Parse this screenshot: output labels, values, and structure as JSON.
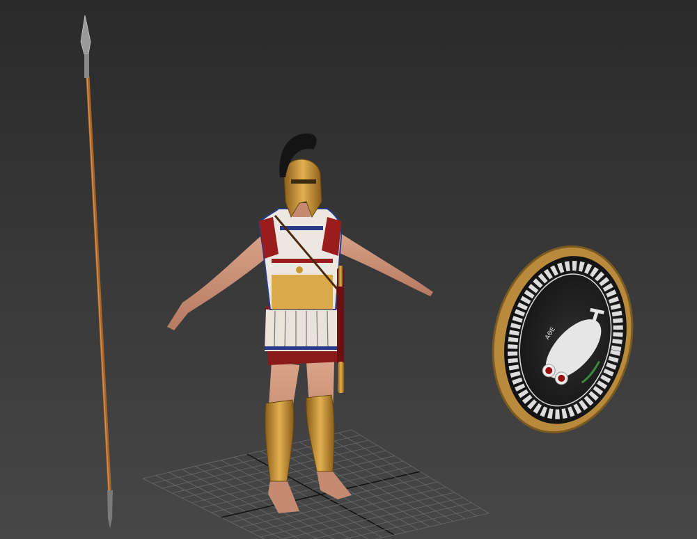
{
  "viewport": {
    "shield_inscription": "ΑΘΕ",
    "colors": {
      "background_top": "#2a2a2a",
      "background_bottom": "#474747",
      "grid": "#6a6a6a",
      "grid_axis": "#111111",
      "bronze": "#c8962e",
      "skin": "#c89077",
      "tunic_red": "#8a1a1a",
      "shield_black": "#1c1c1c",
      "shield_rim": "#b98a3c"
    }
  }
}
